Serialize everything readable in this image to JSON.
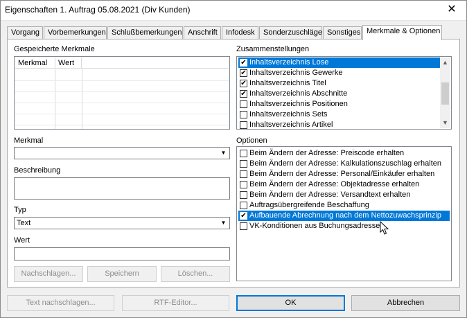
{
  "window": {
    "title": "Eigenschaften 1. Auftrag 05.08.2021 (Div Kunden)",
    "close_glyph": "✕"
  },
  "tabs": [
    {
      "label": "Vorgang"
    },
    {
      "label": "Vorbemerkungen"
    },
    {
      "label": "Schlußbemerkungen"
    },
    {
      "label": "Anschrift"
    },
    {
      "label": "Infodesk"
    },
    {
      "label": "Sonderzuschläge"
    },
    {
      "label": "Sonstiges"
    },
    {
      "label": "Merkmale & Optionen",
      "active": true
    }
  ],
  "left": {
    "saved_label": "Gespeicherte Merkmale",
    "grid_headers": [
      "Merkmal",
      "Wert"
    ],
    "merkmal_label": "Merkmal",
    "merkmal_value": "",
    "beschreibung_label": "Beschreibung",
    "beschreibung_value": "",
    "typ_label": "Typ",
    "typ_value": "Text",
    "wert_label": "Wert",
    "wert_value": "",
    "buttons": {
      "nachschlagen": "Nachschlagen...",
      "speichern": "Speichern",
      "loeschen": "Löschen..."
    }
  },
  "right": {
    "zusammen_label": "Zusammenstellungen",
    "zusammen_items": [
      {
        "label": "Inhaltsverzeichnis Lose",
        "checked": true,
        "selected": true
      },
      {
        "label": "Inhaltsverzeichnis Gewerke",
        "checked": true
      },
      {
        "label": "Inhaltsverzeichnis Titel",
        "checked": true
      },
      {
        "label": "Inhaltsverzeichnis Abschnitte",
        "checked": true
      },
      {
        "label": "Inhaltsverzeichnis Positionen",
        "checked": false
      },
      {
        "label": "Inhaltsverzeichnis Sets",
        "checked": false
      },
      {
        "label": "Inhaltsverzeichnis Artikel",
        "checked": false
      }
    ],
    "optionen_label": "Optionen",
    "optionen_items": [
      {
        "label": "Beim Ändern der Adresse: Preiscode erhalten",
        "checked": false
      },
      {
        "label": "Beim Ändern der Adresse: Kalkulationszuschlag erhalten",
        "checked": false
      },
      {
        "label": "Beim Ändern der Adresse: Personal/Einkäufer erhalten",
        "checked": false
      },
      {
        "label": "Beim Ändern der Adresse: Objektadresse erhalten",
        "checked": false
      },
      {
        "label": "Beim Ändern der Adresse: Versandtext erhalten",
        "checked": false
      },
      {
        "label": "Auftragsübergreifende Beschaffung",
        "checked": false
      },
      {
        "label": "Aufbauende Abrechnung nach dem Nettozuwachsprinzip",
        "checked": true,
        "selected": true
      },
      {
        "label": "VK-Konditionen aus Buchungsadresse",
        "checked": false
      }
    ]
  },
  "footer": {
    "text_nachschlagen": "Text nachschlagen...",
    "rtf_editor": "RTF-Editor...",
    "ok": "OK",
    "abbrechen": "Abbrechen"
  },
  "colors": {
    "selection": "#0078d7",
    "window_bg": "#f0f0f0"
  },
  "icons": {
    "check": "✔",
    "scroll_up": "▲",
    "scroll_down": "▼",
    "dropdown": "▼"
  }
}
